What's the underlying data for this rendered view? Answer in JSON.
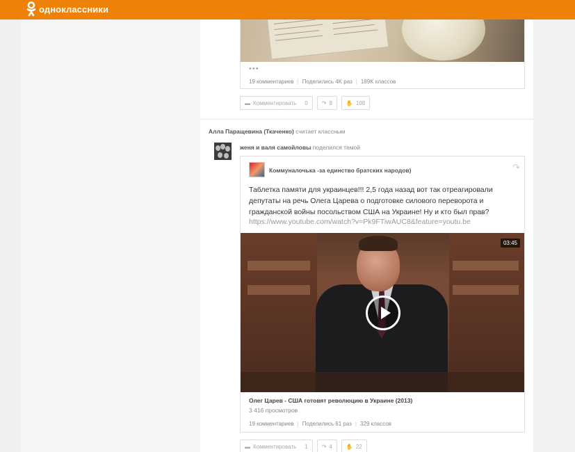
{
  "header": {
    "brand": "одноклассники",
    "brand_icon": "ok-logo-icon",
    "bg_color": "#ee8208"
  },
  "post1": {
    "more_dots": "•••",
    "stats": {
      "comments": "19 комментариев",
      "shares": "Поделились 4K раз",
      "likes": "189K классов"
    },
    "actions": {
      "comment_label": "Комментировать",
      "comment_count": "0",
      "share_count": "8",
      "like_count": "108"
    }
  },
  "post2": {
    "actor_name": "Алла Паращевина (Ткаченко)",
    "actor_action": "считает классным",
    "sharer_name": "женя и валя самойловы",
    "sharer_action": "поделился темой",
    "group_name": "Коммуналочька -за единство братских народов)",
    "text": "Таблетка памяти для украинцев!!! 2,5 года назад вот так отреагировали депутаты на речь Олега Царева о подготовке силового переворота и гражданской войны посольством США на Украине! Ну и кто был прав?",
    "link": "https://www.youtube.com/watch?v=Pk9FTiwAUC8&feature=youtu.be",
    "video": {
      "duration": "03:45",
      "title": "Олег Царев - США готовят революцию в Украине (2013)",
      "views": "3 416 просмотров"
    },
    "stats": {
      "comments": "19 комментариев",
      "shares": "Поделились 61 раз",
      "likes": "329 классов"
    },
    "actions": {
      "comment_label": "Комментировать",
      "comment_count": "1",
      "share_count": "4",
      "like_count": "22"
    }
  }
}
